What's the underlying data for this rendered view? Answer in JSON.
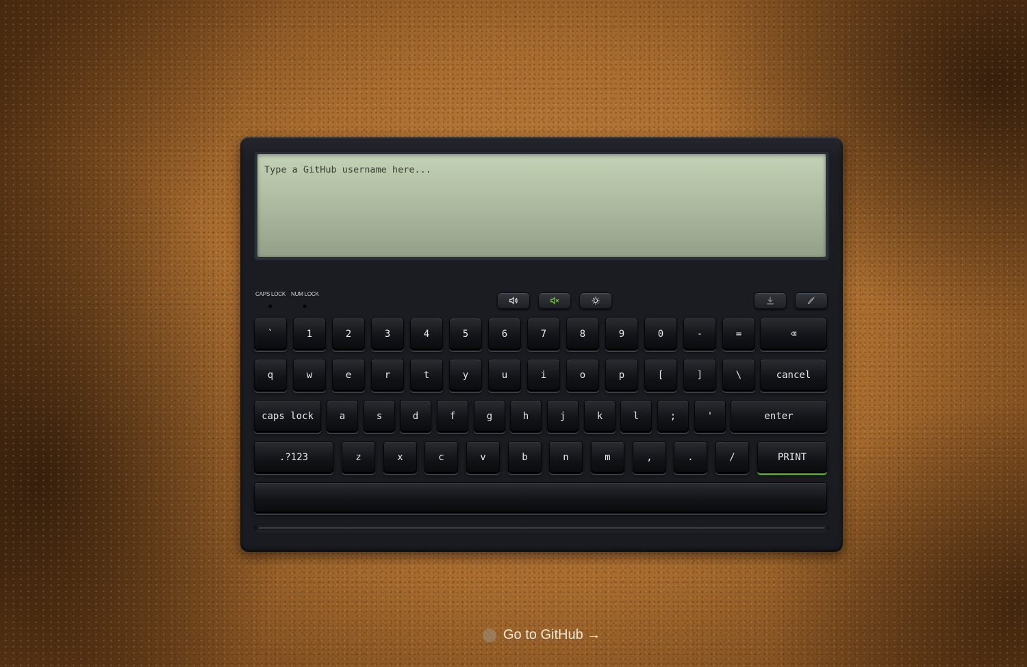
{
  "display": {
    "placeholder": "Type a GitHub username here...",
    "value": ""
  },
  "indicators": {
    "caps_lock": {
      "label": "CAPS LOCK",
      "on": false
    },
    "num_lock": {
      "label": "NUM LOCK",
      "on": false
    }
  },
  "controls": {
    "sound_on": {
      "icon": "speaker-icon"
    },
    "mute": {
      "icon": "speaker-mute-icon",
      "active": true,
      "active_color": "#7cd63a"
    },
    "brightness": {
      "icon": "sun-icon"
    },
    "download": {
      "icon": "download-icon"
    },
    "pen": {
      "icon": "pen-icon"
    }
  },
  "keys": {
    "row1": [
      "`",
      "1",
      "2",
      "3",
      "4",
      "5",
      "6",
      "7",
      "8",
      "9",
      "0",
      "-",
      "=",
      "⌫"
    ],
    "row2": [
      "q",
      "w",
      "e",
      "r",
      "t",
      "y",
      "u",
      "i",
      "o",
      "p",
      "[",
      "]",
      "\\",
      "cancel"
    ],
    "row3": [
      "caps lock",
      "a",
      "s",
      "d",
      "f",
      "g",
      "h",
      "j",
      "k",
      "l",
      ";",
      "'",
      "enter"
    ],
    "row4": [
      ".?123",
      "z",
      "x",
      "c",
      "v",
      "b",
      "n",
      "m",
      ",",
      ".",
      "/",
      "PRINT"
    ],
    "space": ""
  },
  "footer": {
    "link_text": "Go to GitHub →"
  },
  "colors": {
    "print_accent": "#4fae22",
    "screen": "#b7c4a9"
  }
}
